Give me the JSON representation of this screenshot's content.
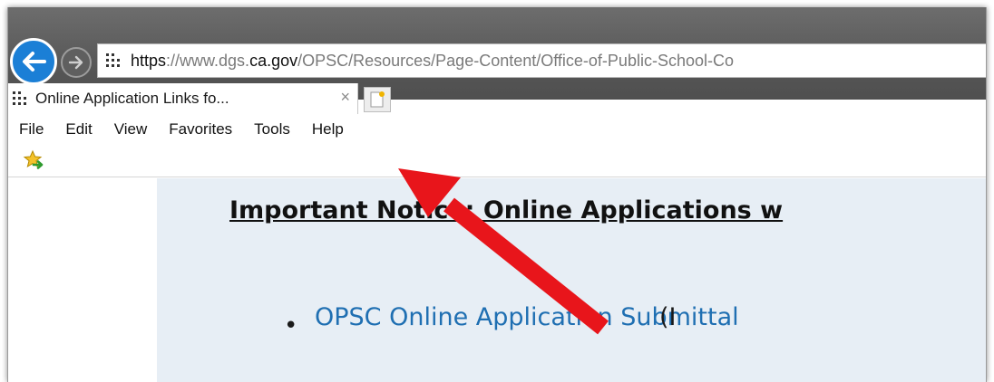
{
  "browser": {
    "address_url": {
      "scheme": "https",
      "pre_domain": "://www.dgs.",
      "domain": "ca.gov",
      "path": "/OPSC/Resources/Page-Content/Office-of-Public-School-Co"
    },
    "tab": {
      "label": "Online Application Links fo...",
      "close_glyph": "×"
    },
    "menu": [
      "File",
      "Edit",
      "View",
      "Favorites",
      "Tools",
      "Help"
    ]
  },
  "page": {
    "notice_heading": "Important Notice: Online Applications w",
    "list_item_link": "OPSC Online Application Submittal",
    "list_item_suffix": "(I",
    "bullet": "•"
  },
  "annotation": {
    "arrow_color": "#e8151b"
  },
  "colors": {
    "link": "#1f6fb2",
    "back_button": "#1b7fd6",
    "panel_bg": "#e7eef5"
  },
  "icons": {
    "back": "back-arrow-icon",
    "forward": "forward-arrow-icon",
    "site": "site-grid-icon",
    "new_tab": "new-tab-icon",
    "favorites": "add-favorite-star-icon"
  }
}
